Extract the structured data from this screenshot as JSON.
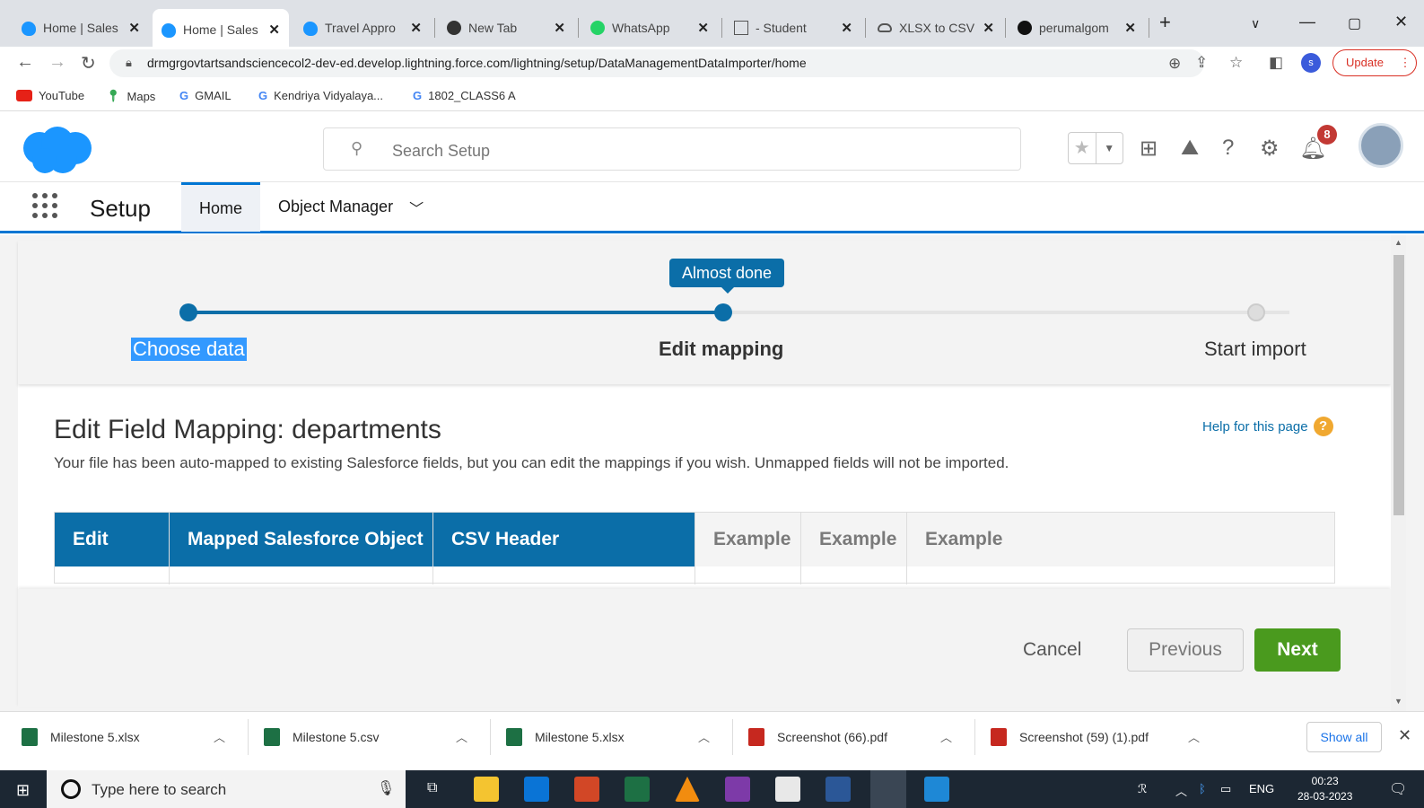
{
  "browser": {
    "tabs": [
      {
        "title": "Home | Sales",
        "icon": "salesforce-icon"
      },
      {
        "title": "Home | Sales",
        "icon": "salesforce-icon"
      },
      {
        "title": "Travel Appro",
        "icon": "salesforce-icon"
      },
      {
        "title": "New Tab",
        "icon": "chrome-icon"
      },
      {
        "title": "WhatsApp",
        "icon": "whatsapp-icon"
      },
      {
        "title": "- Student",
        "icon": "sheet-icon"
      },
      {
        "title": "XLSX to CSV",
        "icon": "cloud-icon"
      },
      {
        "title": "perumalgom",
        "icon": "github-icon"
      }
    ],
    "url": "drmgrgovtartsandsciencecol2-dev-ed.develop.lightning.force.com/lightning/setup/DataManagementDataImporter/home",
    "profile_letter": "s",
    "update_label": "Update",
    "bookmarks": [
      {
        "label": "YouTube"
      },
      {
        "label": "Maps"
      },
      {
        "label": "GMAIL"
      },
      {
        "label": "Kendriya Vidyalaya..."
      },
      {
        "label": "1802_CLASS6 A"
      }
    ]
  },
  "salesforce": {
    "search_placeholder": "Search Setup",
    "notification_count": "8",
    "app_name": "Setup",
    "nav_tabs": [
      {
        "label": "Home"
      },
      {
        "label": "Object Manager"
      }
    ]
  },
  "wizard": {
    "tooltip": "Almost done",
    "steps": [
      {
        "label": "Choose data"
      },
      {
        "label": "Edit mapping"
      },
      {
        "label": "Start import"
      }
    ],
    "title": "Edit Field Mapping: departments",
    "description": "Your file has been auto-mapped to existing Salesforce fields, but you can edit the mappings if you wish. Unmapped fields will not be imported.",
    "help_link": "Help for this page",
    "table_headers": [
      "Edit",
      "Mapped Salesforce Object",
      "CSV Header",
      "Example",
      "Example",
      "Example"
    ],
    "buttons": {
      "cancel": "Cancel",
      "previous": "Previous",
      "next": "Next"
    }
  },
  "downloads": {
    "items": [
      {
        "name": "Milestone 5.xlsx",
        "type": "xlsx"
      },
      {
        "name": "Milestone 5.csv",
        "type": "csv"
      },
      {
        "name": "Milestone 5.xlsx",
        "type": "xlsx"
      },
      {
        "name": "Screenshot (66).pdf",
        "type": "pdf"
      },
      {
        "name": "Screenshot (59) (1).pdf",
        "type": "pdf"
      }
    ],
    "show_all": "Show all"
  },
  "taskbar": {
    "search_placeholder": "Type here to search",
    "language": "ENG",
    "time": "00:23",
    "date": "28-03-2023"
  },
  "colors": {
    "salesforce_blue": "#0b6ea8",
    "next_green": "#4a9a1e",
    "badge_red": "#c23934"
  }
}
